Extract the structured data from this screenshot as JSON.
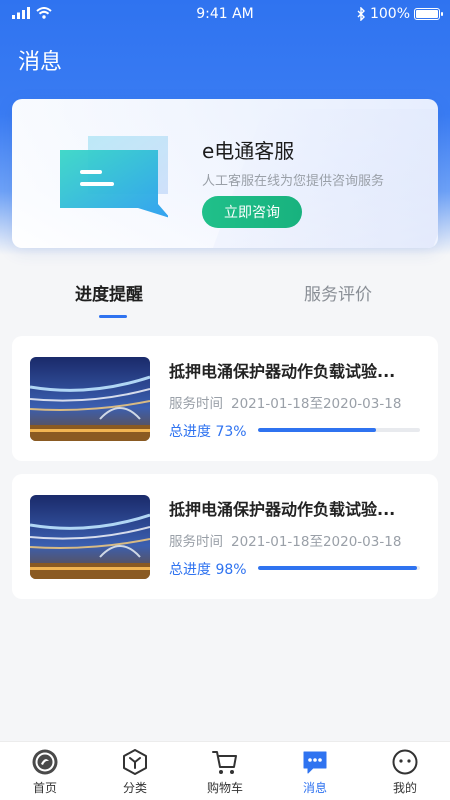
{
  "status": {
    "time": "9:41 AM",
    "battery": "100%"
  },
  "page": {
    "title": "消息"
  },
  "service": {
    "title": "e电通客服",
    "subtitle": "人工客服在线为您提供咨询服务",
    "button": "立即咨询"
  },
  "tabs": [
    {
      "label": "进度提醒",
      "active": true
    },
    {
      "label": "服务评价",
      "active": false
    }
  ],
  "tasks": [
    {
      "title": "抵押电涌保护器动作负载试验...",
      "time_label": "服务时间",
      "time_value": "2021-01-18至2020-03-18",
      "progress_label": "总进度 73%",
      "progress": 0.73
    },
    {
      "title": "抵押电涌保护器动作负载试验...",
      "time_label": "服务时间",
      "time_value": "2021-01-18至2020-03-18",
      "progress_label": "总进度 98%",
      "progress": 0.98
    }
  ],
  "tabbar": [
    {
      "label": "首页",
      "icon": "home-logo-icon"
    },
    {
      "label": "分类",
      "icon": "category-icon"
    },
    {
      "label": "购物车",
      "icon": "cart-icon"
    },
    {
      "label": "消息",
      "icon": "message-icon",
      "active": true
    },
    {
      "label": "我的",
      "icon": "profile-icon"
    }
  ],
  "colors": {
    "primary": "#2f73f0",
    "accent_green": "#20c08a"
  }
}
